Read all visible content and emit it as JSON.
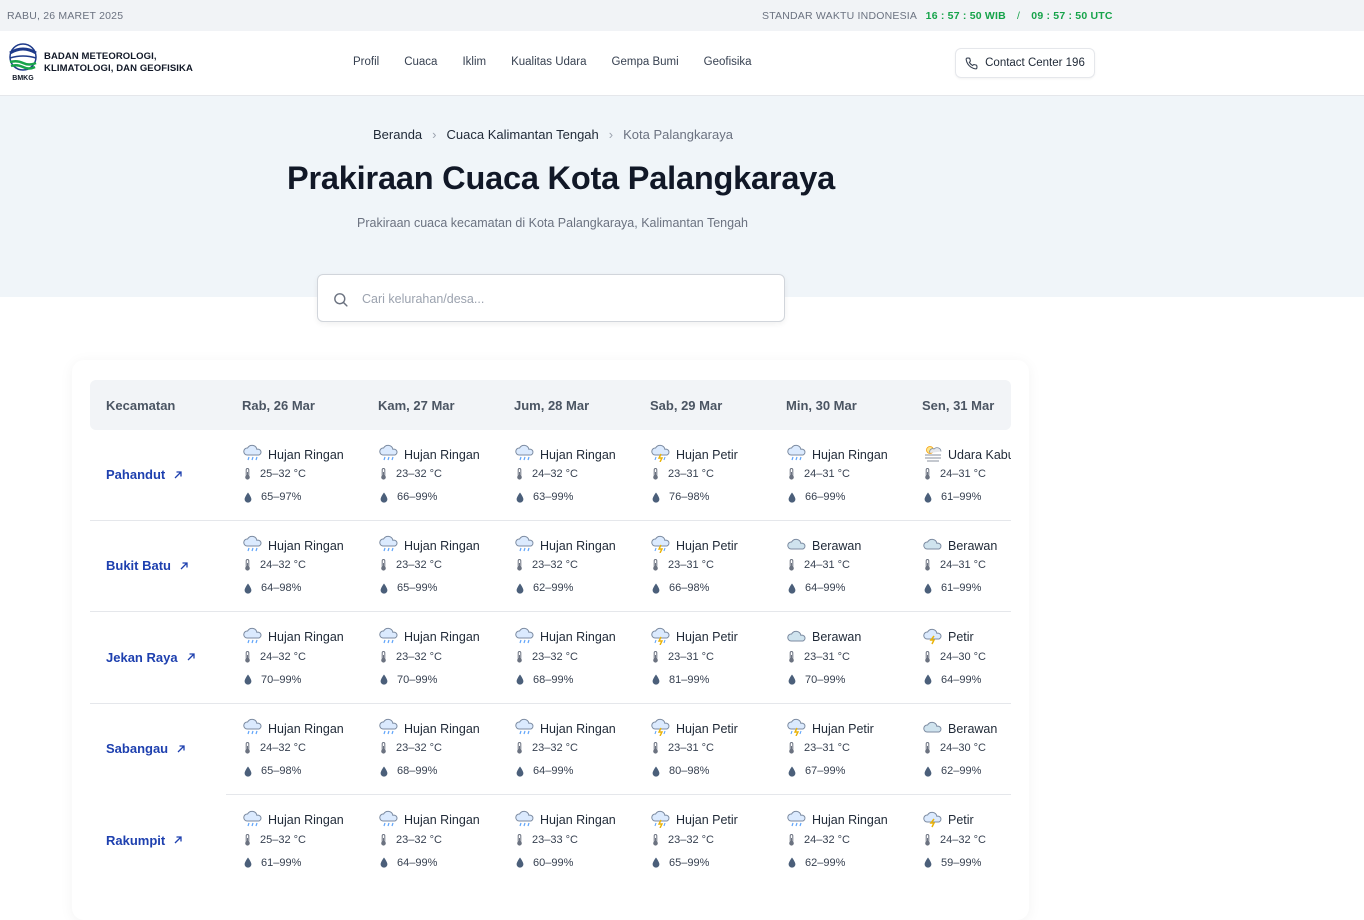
{
  "topbar": {
    "date": "RABU, 26 MARET 2025",
    "time_label": "STANDAR WAKTU INDONESIA",
    "wib": "16 : 57 : 50 WIB",
    "separator": "/",
    "utc": "09 : 57 : 50 UTC"
  },
  "header": {
    "logo_caption": "BMKG",
    "org_line1": "BADAN METEOROLOGI,",
    "org_line2": "KLIMATOLOGI, DAN GEOFISIKA",
    "nav": [
      "Profil",
      "Cuaca",
      "Iklim",
      "Kualitas Udara",
      "Gempa Bumi",
      "Geofisika"
    ],
    "contact": "Contact Center 196"
  },
  "breadcrumb": [
    "Beranda",
    "Cuaca Kalimantan Tengah",
    "Kota Palangkaraya"
  ],
  "page": {
    "title": "Prakiraan Cuaca Kota Palangkaraya",
    "subtitle": "Prakiraan cuaca kecamatan di Kota Palangkaraya, Kalimantan Tengah"
  },
  "search": {
    "placeholder": "Cari kelurahan/desa..."
  },
  "table": {
    "header": "Kecamatan",
    "days": [
      "Rab, 26 Mar",
      "Kam, 27 Mar",
      "Jum, 28 Mar",
      "Sab, 29 Mar",
      "Min, 30 Mar",
      "Sen, 31 Mar"
    ],
    "rows": [
      {
        "name": "Pahandut",
        "cells": [
          {
            "icon": "rain-cloud-icon",
            "cond": "Hujan Ringan",
            "temp": "25–32 °C",
            "hum": "65–97%"
          },
          {
            "icon": "rain-cloud-icon",
            "cond": "Hujan Ringan",
            "temp": "23–32 °C",
            "hum": "66–99%"
          },
          {
            "icon": "rain-cloud-icon",
            "cond": "Hujan Ringan",
            "temp": "24–32 °C",
            "hum": "63–99%"
          },
          {
            "icon": "thunderstorm-icon",
            "cond": "Hujan Petir",
            "temp": "23–31 °C",
            "hum": "76–98%"
          },
          {
            "icon": "rain-cloud-icon",
            "cond": "Hujan Ringan",
            "temp": "24–31 °C",
            "hum": "66–99%"
          },
          {
            "icon": "haze-icon",
            "cond": "Udara Kabur",
            "temp": "24–31 °C",
            "hum": "61–99%"
          }
        ]
      },
      {
        "name": "Bukit Batu",
        "cells": [
          {
            "icon": "rain-cloud-icon",
            "cond": "Hujan Ringan",
            "temp": "24–32 °C",
            "hum": "64–98%"
          },
          {
            "icon": "rain-cloud-icon",
            "cond": "Hujan Ringan",
            "temp": "23–32 °C",
            "hum": "65–99%"
          },
          {
            "icon": "rain-cloud-icon",
            "cond": "Hujan Ringan",
            "temp": "23–32 °C",
            "hum": "62–99%"
          },
          {
            "icon": "thunderstorm-icon",
            "cond": "Hujan Petir",
            "temp": "23–31 °C",
            "hum": "66–98%"
          },
          {
            "icon": "cloud-icon",
            "cond": "Berawan",
            "temp": "24–31 °C",
            "hum": "64–99%"
          },
          {
            "icon": "cloud-icon",
            "cond": "Berawan",
            "temp": "24–31 °C",
            "hum": "61–99%"
          }
        ]
      },
      {
        "name": "Jekan Raya",
        "cells": [
          {
            "icon": "rain-cloud-icon",
            "cond": "Hujan Ringan",
            "temp": "24–32 °C",
            "hum": "70–99%"
          },
          {
            "icon": "rain-cloud-icon",
            "cond": "Hujan Ringan",
            "temp": "23–32 °C",
            "hum": "70–99%"
          },
          {
            "icon": "rain-cloud-icon",
            "cond": "Hujan Ringan",
            "temp": "23–32 °C",
            "hum": "68–99%"
          },
          {
            "icon": "thunderstorm-icon",
            "cond": "Hujan Petir",
            "temp": "23–31 °C",
            "hum": "81–99%"
          },
          {
            "icon": "cloud-icon",
            "cond": "Berawan",
            "temp": "23–31 °C",
            "hum": "70–99%"
          },
          {
            "icon": "lightning-icon",
            "cond": "Petir",
            "temp": "24–30 °C",
            "hum": "64–99%"
          }
        ]
      },
      {
        "name": "Sabangau",
        "cells": [
          {
            "icon": "rain-cloud-icon",
            "cond": "Hujan Ringan",
            "temp": "24–32 °C",
            "hum": "65–98%"
          },
          {
            "icon": "rain-cloud-icon",
            "cond": "Hujan Ringan",
            "temp": "23–32 °C",
            "hum": "68–99%"
          },
          {
            "icon": "rain-cloud-icon",
            "cond": "Hujan Ringan",
            "temp": "23–32 °C",
            "hum": "64–99%"
          },
          {
            "icon": "thunderstorm-icon",
            "cond": "Hujan Petir",
            "temp": "23–31 °C",
            "hum": "80–98%"
          },
          {
            "icon": "thunderstorm-icon",
            "cond": "Hujan Petir",
            "temp": "23–31 °C",
            "hum": "67–99%"
          },
          {
            "icon": "cloud-icon",
            "cond": "Berawan",
            "temp": "24–30 °C",
            "hum": "62–99%"
          }
        ]
      },
      {
        "name": "Rakumpit",
        "cells": [
          {
            "icon": "rain-cloud-icon",
            "cond": "Hujan Ringan",
            "temp": "25–32 °C",
            "hum": "61–99%"
          },
          {
            "icon": "rain-cloud-icon",
            "cond": "Hujan Ringan",
            "temp": "23–32 °C",
            "hum": "64–99%"
          },
          {
            "icon": "rain-cloud-icon",
            "cond": "Hujan Ringan",
            "temp": "23–33 °C",
            "hum": "60–99%"
          },
          {
            "icon": "thunderstorm-icon",
            "cond": "Hujan Petir",
            "temp": "23–32 °C",
            "hum": "65–99%"
          },
          {
            "icon": "rain-cloud-icon",
            "cond": "Hujan Ringan",
            "temp": "24–32 °C",
            "hum": "62–99%"
          },
          {
            "icon": "lightning-icon",
            "cond": "Petir",
            "temp": "24–32 °C",
            "hum": "59–99%"
          }
        ]
      }
    ]
  },
  "colors": {
    "accent_link": "#1e40af",
    "clock_green": "#16a34a",
    "hero_bg": "#f0f5f9",
    "table_head_bg": "#f2f4f7"
  }
}
